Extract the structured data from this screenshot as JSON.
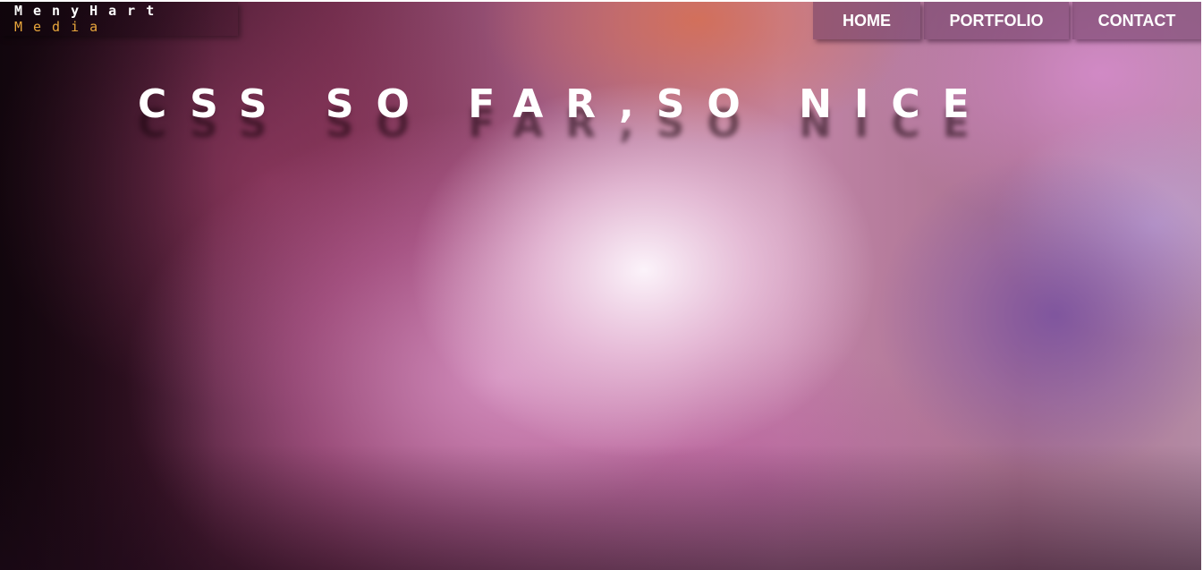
{
  "logo": {
    "line1": "MenyHart",
    "line2": "Media",
    "line1_color": "#ffffff",
    "line2_color": "#e8a63c"
  },
  "nav": {
    "items": [
      {
        "label": "HOME"
      },
      {
        "label": "PORTFOLIO"
      },
      {
        "label": "CONTACT"
      }
    ]
  },
  "hero": {
    "headline": "CSS SO FAR,SO NICE"
  }
}
